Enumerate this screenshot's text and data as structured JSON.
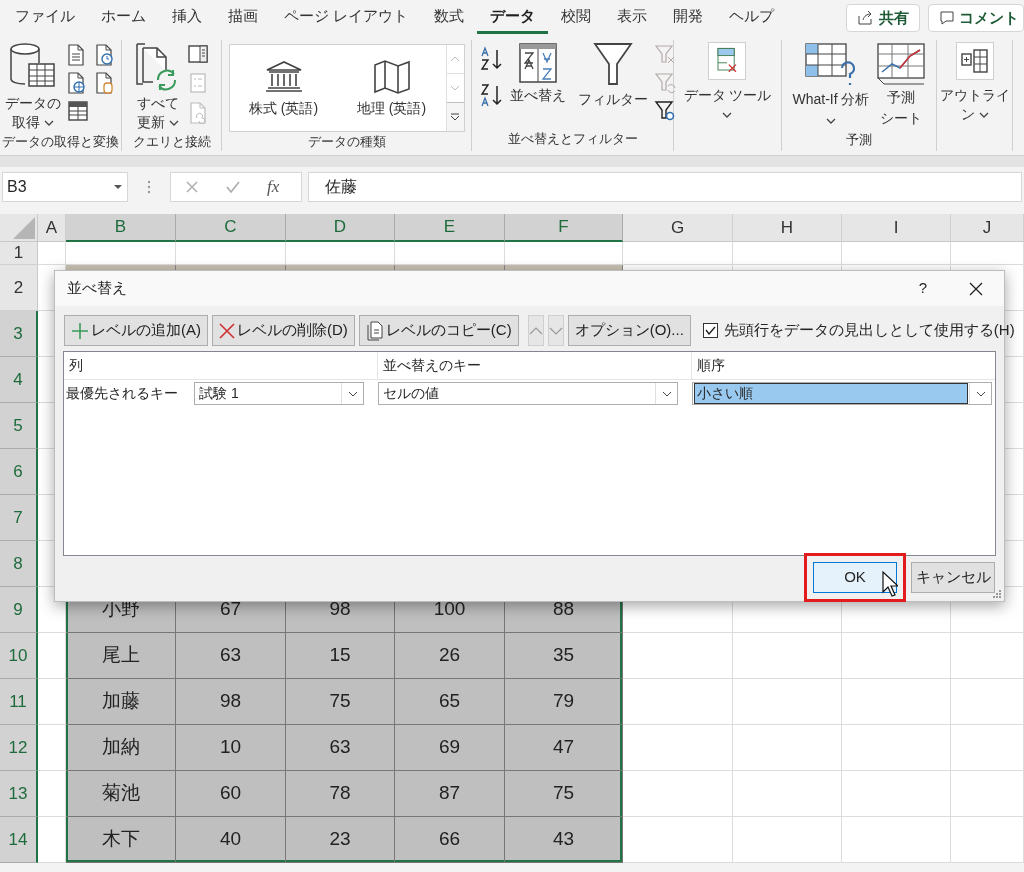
{
  "ribbon": {
    "tabs": [
      {
        "label": "ファイル",
        "selected": false
      },
      {
        "label": "ホーム",
        "selected": false
      },
      {
        "label": "挿入",
        "selected": false
      },
      {
        "label": "描画",
        "selected": false
      },
      {
        "label": "ページ レイアウト",
        "selected": false
      },
      {
        "label": "数式",
        "selected": false
      },
      {
        "label": "データ",
        "selected": true
      },
      {
        "label": "校閲",
        "selected": false
      },
      {
        "label": "表示",
        "selected": false
      },
      {
        "label": "開発",
        "selected": false
      },
      {
        "label": "ヘルプ",
        "selected": false
      }
    ],
    "share_button": "共有",
    "comment_button": "コメント",
    "groups": [
      {
        "label": "データの取得と変換",
        "commands": [
          {
            "lines": [
              "データの",
              "取得"
            ],
            "dropdown": true
          }
        ]
      },
      {
        "label": "クエリと接続",
        "commands": [
          {
            "lines": [
              "すべて",
              "更新"
            ],
            "dropdown": true
          }
        ]
      },
      {
        "label": "データの種類",
        "commands": [
          {
            "lines": [
              "株式 (英語)"
            ],
            "dropdown": false
          },
          {
            "lines": [
              "地理 (英語)"
            ],
            "dropdown": false
          }
        ]
      },
      {
        "label": "並べ替えとフィルター",
        "commands": [
          {
            "lines": [
              "並べ替え"
            ],
            "dropdown": false
          },
          {
            "lines": [
              "フィルター"
            ],
            "dropdown": false
          }
        ]
      },
      {
        "commands": [
          {
            "lines": [
              "データ ツール"
            ],
            "dropdown": true
          }
        ]
      },
      {
        "label": "予測",
        "commands": [
          {
            "lines": [
              "What-If 分析"
            ],
            "dropdown": true
          },
          {
            "lines": [
              "予測",
              "シート"
            ],
            "dropdown": false
          }
        ]
      },
      {
        "commands": [
          {
            "lines": [
              "アウトライ",
              "ン"
            ],
            "dropdown": true
          }
        ]
      }
    ]
  },
  "formula_bar": {
    "name_box": "B3",
    "function_label": "fx",
    "value": "佐藤"
  },
  "sheet": {
    "columns": [
      {
        "label": "A",
        "selected": false
      },
      {
        "label": "B",
        "selected": true
      },
      {
        "label": "C",
        "selected": true
      },
      {
        "label": "D",
        "selected": true
      },
      {
        "label": "E",
        "selected": true
      },
      {
        "label": "F",
        "selected": true
      },
      {
        "label": "G",
        "selected": false
      },
      {
        "label": "H",
        "selected": false
      },
      {
        "label": "I",
        "selected": false
      },
      {
        "label": "J",
        "selected": false
      }
    ],
    "rows": [
      {
        "label": "1",
        "selected": false
      },
      {
        "label": "2",
        "selected": false,
        "color": "#c8c0b2"
      },
      {
        "label": "3",
        "selected": true
      },
      {
        "label": "4",
        "selected": true
      },
      {
        "label": "5",
        "selected": true
      },
      {
        "label": "6",
        "selected": true
      },
      {
        "label": "7",
        "selected": true
      },
      {
        "label": "8",
        "selected": true
      },
      {
        "label": "9",
        "selected": true,
        "cells": [
          "小野",
          "67",
          "98",
          "100",
          "88"
        ]
      },
      {
        "label": "10",
        "selected": true,
        "cells": [
          "尾上",
          "63",
          "15",
          "26",
          "35"
        ]
      },
      {
        "label": "11",
        "selected": true,
        "cells": [
          "加藤",
          "98",
          "75",
          "65",
          "79"
        ]
      },
      {
        "label": "12",
        "selected": true,
        "cells": [
          "加納",
          "10",
          "63",
          "69",
          "47"
        ]
      },
      {
        "label": "13",
        "selected": true,
        "cells": [
          "菊池",
          "60",
          "78",
          "87",
          "75"
        ]
      },
      {
        "label": "14",
        "selected": true,
        "cells": [
          "木下",
          "40",
          "23",
          "66",
          "43"
        ]
      }
    ]
  },
  "dialog": {
    "title": "並べ替え",
    "help": "?",
    "toolbar": [
      {
        "kind": "add",
        "label": "レベルの追加(A)",
        "disabled": false
      },
      {
        "kind": "delete",
        "label": "レベルの削除(D)",
        "disabled": false
      },
      {
        "kind": "copy",
        "label": "レベルのコピー(C)",
        "disabled": false
      },
      {
        "kind": "up",
        "disabled": true
      },
      {
        "kind": "down",
        "disabled": true
      },
      {
        "kind": "options",
        "label": "オプション(O)...",
        "disabled": false
      }
    ],
    "header_checkbox": {
      "label": "先頭行をデータの見出しとして使用する(H)",
      "checked": true
    },
    "columns": [
      "列",
      "並べ替えのキー",
      "順序"
    ],
    "levels": [
      {
        "label": "最優先されるキー",
        "column": "試験 1",
        "sort_on": "セルの値",
        "order": "小さい順",
        "order_selected": true
      }
    ],
    "buttons": [
      {
        "label": "OK",
        "default": true,
        "highlighted": true
      },
      {
        "label": "キャンセル",
        "default": false,
        "highlighted": false
      }
    ]
  }
}
